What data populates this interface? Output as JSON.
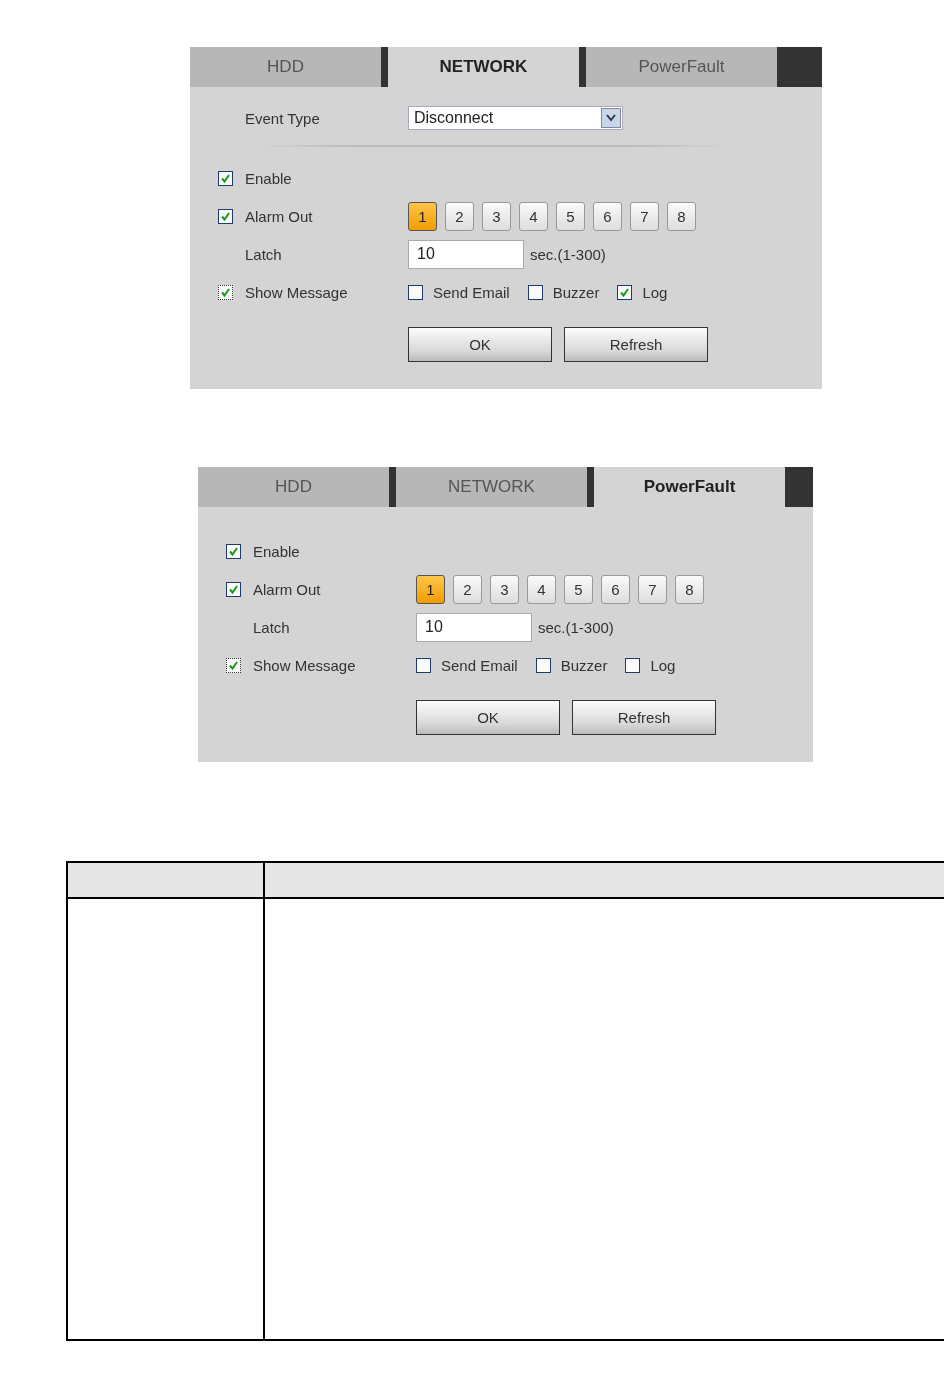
{
  "panels": [
    {
      "tabs": [
        {
          "label": "HDD",
          "selected": false
        },
        {
          "label": "NETWORK",
          "selected": true
        },
        {
          "label": "PowerFault",
          "selected": false
        }
      ],
      "event_type": {
        "label": "Event Type",
        "value": "Disconnect"
      },
      "enable": {
        "label": "Enable",
        "checked": true
      },
      "alarm_out": {
        "label": "Alarm Out",
        "checked": true,
        "channels": [
          {
            "label": "1",
            "selected": true
          },
          {
            "label": "2",
            "selected": false
          },
          {
            "label": "3",
            "selected": false
          },
          {
            "label": "4",
            "selected": false
          },
          {
            "label": "5",
            "selected": false
          },
          {
            "label": "6",
            "selected": false
          },
          {
            "label": "7",
            "selected": false
          },
          {
            "label": "8",
            "selected": false
          }
        ]
      },
      "latch": {
        "label": "Latch",
        "value": "10",
        "unit": "sec.(1-300)"
      },
      "show_message": {
        "label": "Show Message",
        "checked": true
      },
      "actions": [
        {
          "label": "Send Email",
          "checked": false
        },
        {
          "label": "Buzzer",
          "checked": false
        },
        {
          "label": "Log",
          "checked": true
        }
      ],
      "buttons": [
        "OK",
        "Refresh"
      ]
    },
    {
      "tabs": [
        {
          "label": "HDD",
          "selected": false
        },
        {
          "label": "NETWORK",
          "selected": false
        },
        {
          "label": "PowerFault",
          "selected": true
        }
      ],
      "enable": {
        "label": "Enable",
        "checked": true
      },
      "alarm_out": {
        "label": "Alarm Out",
        "checked": true,
        "channels": [
          {
            "label": "1",
            "selected": true
          },
          {
            "label": "2",
            "selected": false
          },
          {
            "label": "3",
            "selected": false
          },
          {
            "label": "4",
            "selected": false
          },
          {
            "label": "5",
            "selected": false
          },
          {
            "label": "6",
            "selected": false
          },
          {
            "label": "7",
            "selected": false
          },
          {
            "label": "8",
            "selected": false
          }
        ]
      },
      "latch": {
        "label": "Latch",
        "value": "10",
        "unit": "sec.(1-300)"
      },
      "show_message": {
        "label": "Show Message",
        "checked": true
      },
      "actions": [
        {
          "label": "Send Email",
          "checked": false
        },
        {
          "label": "Buzzer",
          "checked": false
        },
        {
          "label": "Log",
          "checked": false
        }
      ],
      "buttons": [
        "OK",
        "Refresh"
      ]
    }
  ]
}
